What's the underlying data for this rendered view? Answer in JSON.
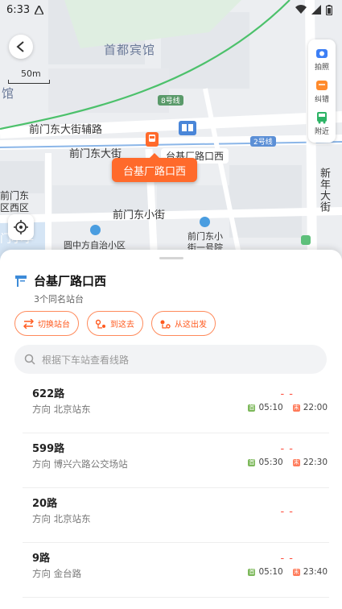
{
  "statusbar": {
    "time": "6:33"
  },
  "map": {
    "labels": {
      "hotel": "首都宾馆",
      "hotel_partial": "馆",
      "road_main": "前门东大街",
      "road_aux": "前门东大街辅路",
      "road_small": "前门东小街",
      "district": "前门东\n区西区",
      "community": "圆中方自治小区",
      "community2": "前门东小\n街一号院",
      "xinnian": "新年大街",
      "line8": "8号线",
      "line2": "2号线",
      "partial_left": "门小学",
      "station_map_label": "台基厂路口西"
    },
    "scale": "50m",
    "callout": "台基厂路口西"
  },
  "tools": [
    {
      "label": "拍照",
      "icon": "camera-icon"
    },
    {
      "label": "纠错",
      "icon": "correction-icon"
    },
    {
      "label": "附近",
      "icon": "nearby-bus-icon"
    }
  ],
  "stop": {
    "title": "台基厂路口西",
    "same_name": "3个同名站台",
    "actions": [
      {
        "label": "切换站台",
        "icon": "switch-icon"
      },
      {
        "label": "到这去",
        "icon": "route-to-icon"
      },
      {
        "label": "从这出发",
        "icon": "route-from-icon"
      }
    ],
    "search_placeholder": "根据下车站查看线路"
  },
  "routes": [
    {
      "name": "622路",
      "dir": "方向 北京站东",
      "dash": "- -",
      "first": "05:10",
      "last": "22:00"
    },
    {
      "name": "599路",
      "dir": "方向 博兴六路公交场站",
      "dash": "- -",
      "first": "05:30",
      "last": "22:30"
    },
    {
      "name": "20路",
      "dir": "方向 北京站东",
      "dash": "- -",
      "first": "",
      "last": ""
    },
    {
      "name": "9路",
      "dir": "方向 金台路",
      "dash": "- -",
      "first": "05:10",
      "last": "23:40"
    }
  ],
  "tags": {
    "first": "首",
    "last": "末"
  }
}
